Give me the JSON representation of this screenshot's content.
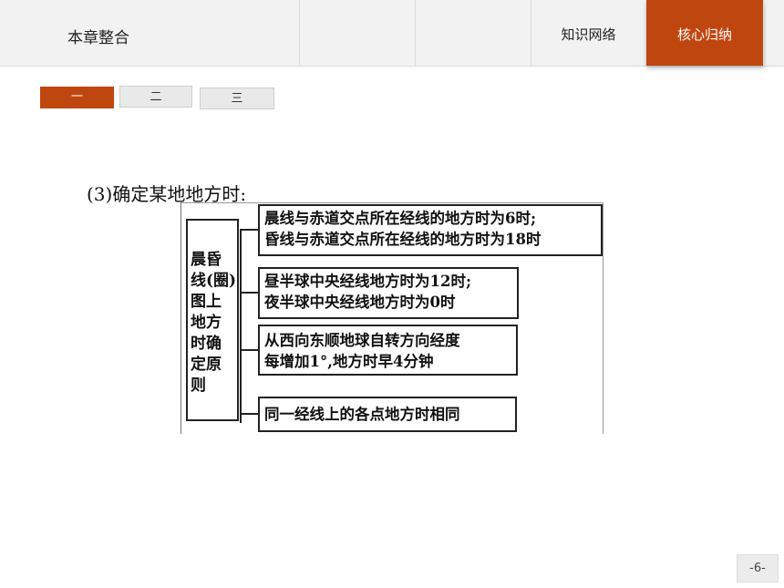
{
  "header": {
    "title": "本章整合",
    "nav": [
      {
        "label": "知识网络",
        "active": false
      },
      {
        "label": "核心归纳",
        "active": true
      }
    ]
  },
  "subtabs": [
    {
      "label": "一",
      "active": true
    },
    {
      "label": "二",
      "active": false
    },
    {
      "label": "三",
      "active": false
    }
  ],
  "content": {
    "heading": "(3)确定某地地方时:",
    "diagram": {
      "root_lines": [
        "晨昏",
        "线(圈)",
        "图上",
        "地方",
        "时确",
        "定原",
        "则"
      ],
      "rules": [
        [
          "晨线与赤道交点所在经线的地方时为6时;",
          "昏线与赤道交点所在经线的地方时为18时"
        ],
        [
          "昼半球中央经线地方时为12时;",
          "夜半球中央经线地方时为0时"
        ],
        [
          "从西向东顺地球自转方向经度",
          "每增加1°,地方时早4分钟"
        ],
        [
          "同一经线上的各点地方时相同"
        ]
      ]
    }
  },
  "footer": {
    "page": "-6-"
  },
  "colors": {
    "accent": "#c0460f",
    "header_bg": "#f2f2f2"
  }
}
